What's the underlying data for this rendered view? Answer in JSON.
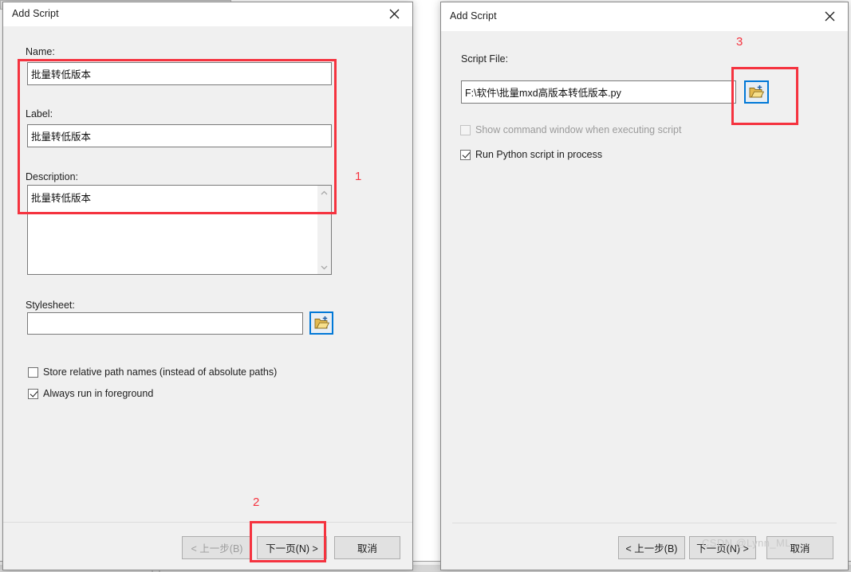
{
  "left_dialog": {
    "title": "Add Script",
    "close_icon": "close-icon",
    "name_label": "Name:",
    "name_value": "批量转低版本",
    "label_label": "Label:",
    "label_value": "批量转低版本",
    "description_label": "Description:",
    "description_value": "批量转低版本",
    "stylesheet_label": "Stylesheet:",
    "stylesheet_value": "",
    "stylesheet_placeholder": "",
    "browse_icon": "open-folder-icon",
    "checkbox_store_relative": "Store relative path names (instead of absolute paths)",
    "checkbox_store_relative_checked": false,
    "checkbox_always_foreground": "Always run in foreground",
    "checkbox_always_foreground_checked": true,
    "btn_back": "< 上一步(B)",
    "btn_back_disabled": true,
    "btn_next": "下一页(N) >",
    "btn_cancel": "取消",
    "scroll_up_icon": "chevron-up-icon",
    "scroll_down_icon": "chevron-down-icon"
  },
  "right_dialog": {
    "title": "Add Script",
    "close_icon": "close-icon",
    "script_file_label": "Script File:",
    "script_file_value": "F:\\软件\\批量mxd高版本转低版本.py",
    "browse_icon": "open-folder-icon",
    "checkbox_show_command": "Show command window when executing script",
    "checkbox_show_command_checked": false,
    "checkbox_show_command_disabled": true,
    "checkbox_run_in_process": "Run Python script in process",
    "checkbox_run_in_process_checked": true,
    "btn_back": "< 上一步(B)",
    "btn_next": "下一页(N) >",
    "btn_cancel": "取消"
  },
  "annotations": {
    "num1": "1",
    "num2": "2",
    "num3": "3",
    "accent_color": "#f5333f"
  },
  "watermark": "CSDN @Lynn_ML"
}
